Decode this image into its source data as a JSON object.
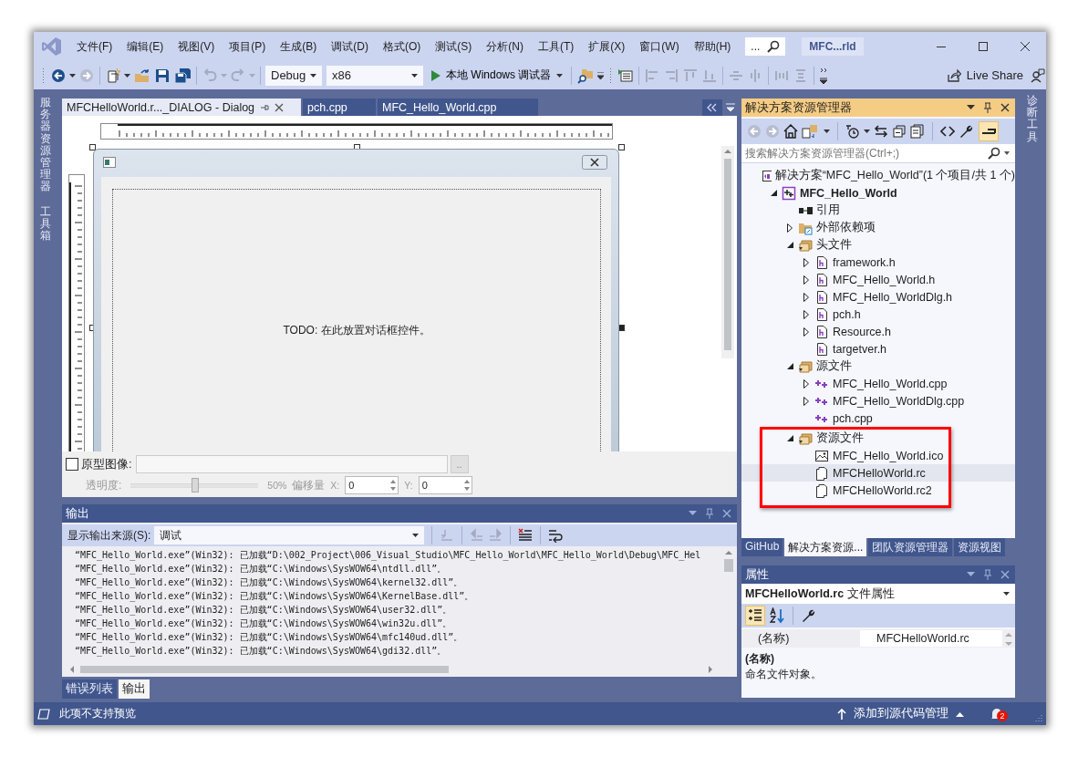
{
  "window": {
    "title": "MFC...rld",
    "search_text": "..."
  },
  "menu": [
    "文件(F)",
    "编辑(E)",
    "视图(V)",
    "项目(P)",
    "生成(B)",
    "调试(D)",
    "格式(O)",
    "测试(S)",
    "分析(N)",
    "工具(T)",
    "扩展(X)",
    "窗口(W)",
    "帮助(H)"
  ],
  "toolbar": {
    "configuration": "Debug",
    "platform": "x86",
    "run_label": "本地 Windows 调试器",
    "live_share": "Live Share"
  },
  "left_strip": [
    "服务器资源管理器",
    "工具箱"
  ],
  "right_strip": [
    "诊断工具"
  ],
  "doc_tabs": [
    {
      "label": "MFCHelloWorld.r..._DIALOG - Dialog",
      "selected": true
    },
    {
      "label": "pch.cpp",
      "selected": false
    },
    {
      "label": "MFC_Hello_World.cpp",
      "selected": false
    }
  ],
  "dialog_editor": {
    "todo_text": "TODO: 在此放置对话框控件。",
    "prototype": {
      "label": "原型图像:",
      "checked": false,
      "browse": "..",
      "opacity_label": "透明度:",
      "opacity": {
        "level": 0.5,
        "reading": "50%"
      },
      "offset_label": "偏移量",
      "x_label": "X:",
      "x_value": "0",
      "y_label": "Y:",
      "y_value": "0"
    }
  },
  "output": {
    "title": "输出",
    "source_label": "显示输出来源(S):",
    "source": "调试",
    "lines": [
      "“MFC_Hello_World.exe”(Win32): 已加载“D:\\002_Project\\006_Visual_Studio\\MFC_Hello_World\\MFC_Hello_World\\Debug\\MFC_Hel",
      "“MFC_Hello_World.exe”(Win32): 已加载“C:\\Windows\\SysWOW64\\ntdll.dll”。",
      "“MFC_Hello_World.exe”(Win32): 已加载“C:\\Windows\\SysWOW64\\kernel32.dll”。",
      "“MFC_Hello_World.exe”(Win32): 已加载“C:\\Windows\\SysWOW64\\KernelBase.dll”。",
      "“MFC_Hello_World.exe”(Win32): 已加载“C:\\Windows\\SysWOW64\\user32.dll”。",
      "“MFC_Hello_World.exe”(Win32): 已加载“C:\\Windows\\SysWOW64\\win32u.dll”。",
      "“MFC_Hello_World.exe”(Win32): 已加载“C:\\Windows\\SysWOW64\\mfc140ud.dll”。",
      "“MFC_Hello_World.exe”(Win32): 已加载“C:\\Windows\\SysWOW64\\gdi32.dll”。"
    ]
  },
  "bottom_tabs": [
    {
      "label": "错误列表",
      "selected": false
    },
    {
      "label": "输出",
      "selected": true
    }
  ],
  "solution_explorer": {
    "title": "解决方案资源管理器",
    "search_placeholder": "搜索解决方案资源管理器(Ctrl+;)",
    "tree": [
      {
        "label": "解决方案“MFC_Hello_World”(1 个项目/共 1 个)",
        "kind": "solution",
        "expandable": false,
        "selected": false,
        "children": [
          {
            "label": "MFC_Hello_World",
            "kind": "project",
            "expandable": true,
            "expanded": true,
            "selected": false,
            "children": [
              {
                "label": "引用",
                "kind": "references",
                "expandable": false,
                "selected": false
              },
              {
                "label": "外部依赖项",
                "kind": "external",
                "expandable": true,
                "expanded": false,
                "selected": false
              },
              {
                "label": "头文件",
                "kind": "folder",
                "expandable": true,
                "expanded": true,
                "selected": false,
                "children": [
                  {
                    "label": "framework.h",
                    "kind": "header",
                    "expandable": true,
                    "expanded": false,
                    "selected": false
                  },
                  {
                    "label": "MFC_Hello_World.h",
                    "kind": "header",
                    "expandable": true,
                    "expanded": false,
                    "selected": false
                  },
                  {
                    "label": "MFC_Hello_WorldDlg.h",
                    "kind": "header",
                    "expandable": true,
                    "expanded": false,
                    "selected": false
                  },
                  {
                    "label": "pch.h",
                    "kind": "header",
                    "expandable": true,
                    "expanded": false,
                    "selected": false
                  },
                  {
                    "label": "Resource.h",
                    "kind": "header",
                    "expandable": true,
                    "expanded": false,
                    "selected": false
                  },
                  {
                    "label": "targetver.h",
                    "kind": "header",
                    "expandable": false,
                    "selected": false
                  }
                ]
              },
              {
                "label": "源文件",
                "kind": "folder",
                "expandable": true,
                "expanded": true,
                "selected": false,
                "children": [
                  {
                    "label": "MFC_Hello_World.cpp",
                    "kind": "cpp",
                    "expandable": true,
                    "expanded": false,
                    "selected": false
                  },
                  {
                    "label": "MFC_Hello_WorldDlg.cpp",
                    "kind": "cpp",
                    "expandable": true,
                    "expanded": false,
                    "selected": false
                  },
                  {
                    "label": "pch.cpp",
                    "kind": "cpp",
                    "expandable": false,
                    "selected": false
                  }
                ]
              },
              {
                "label": "资源文件",
                "kind": "folder",
                "expandable": true,
                "expanded": true,
                "selected": false,
                "highlighted": true,
                "children": [
                  {
                    "label": "MFC_Hello_World.ico",
                    "kind": "image",
                    "expandable": false,
                    "selected": false
                  },
                  {
                    "label": "MFCHelloWorld.rc",
                    "kind": "resource",
                    "expandable": false,
                    "selected": true
                  },
                  {
                    "label": "MFCHelloWorld.rc2",
                    "kind": "resource",
                    "expandable": false,
                    "selected": false
                  }
                ]
              }
            ]
          }
        ]
      }
    ],
    "tabs": [
      {
        "label": "GitHub",
        "selected": false
      },
      {
        "label": "解决方案资源...",
        "selected": true
      },
      {
        "label": "团队资源管理器",
        "selected": false
      },
      {
        "label": "资源视图",
        "selected": false
      }
    ]
  },
  "properties": {
    "title": "属性",
    "object": "**MFCHelloWorld.rc** 文件属性",
    "rows": [
      {
        "name": "(名称)",
        "value": "MFCHelloWorld.rc"
      }
    ],
    "description_title": "(名称)",
    "description": "命名文件对象。"
  },
  "status_bar": {
    "message": "此项不支持预览",
    "source_control": "添加到源代码管理",
    "notifications": "2"
  }
}
